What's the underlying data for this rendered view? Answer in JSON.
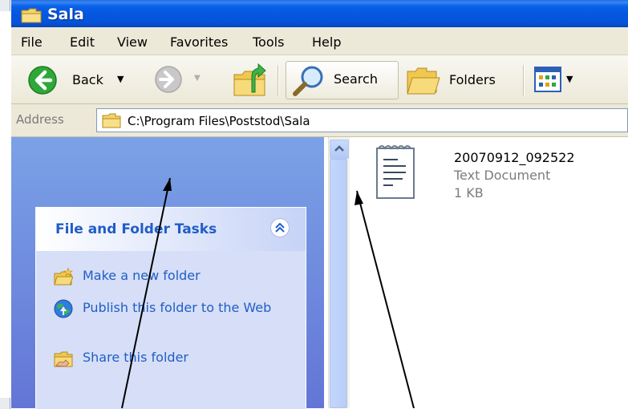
{
  "window": {
    "title": "Sala"
  },
  "menu": [
    "File",
    "Edit",
    "View",
    "Favorites",
    "Tools",
    "Help"
  ],
  "toolbar": {
    "back_label": "Back",
    "search_label": "Search",
    "folders_label": "Folders"
  },
  "address": {
    "label": "Address",
    "path": "C:\\Program Files\\Poststod\\Sala"
  },
  "tasks": {
    "title": "File and Folder Tasks",
    "items": [
      {
        "label": "Make a new folder",
        "icon": "new-folder-icon"
      },
      {
        "label": "Publish this folder to the Web",
        "icon": "publish-web-icon"
      },
      {
        "label": "Share this folder",
        "icon": "share-folder-icon"
      }
    ]
  },
  "file": {
    "name": "20070912_092522",
    "type": "Text Document",
    "size": "1 KB",
    "icon": "text-document-icon"
  },
  "colors": {
    "title_bar": "#0557e0",
    "task_link": "#215dc6",
    "pane_bg": "#7ba2e7"
  }
}
